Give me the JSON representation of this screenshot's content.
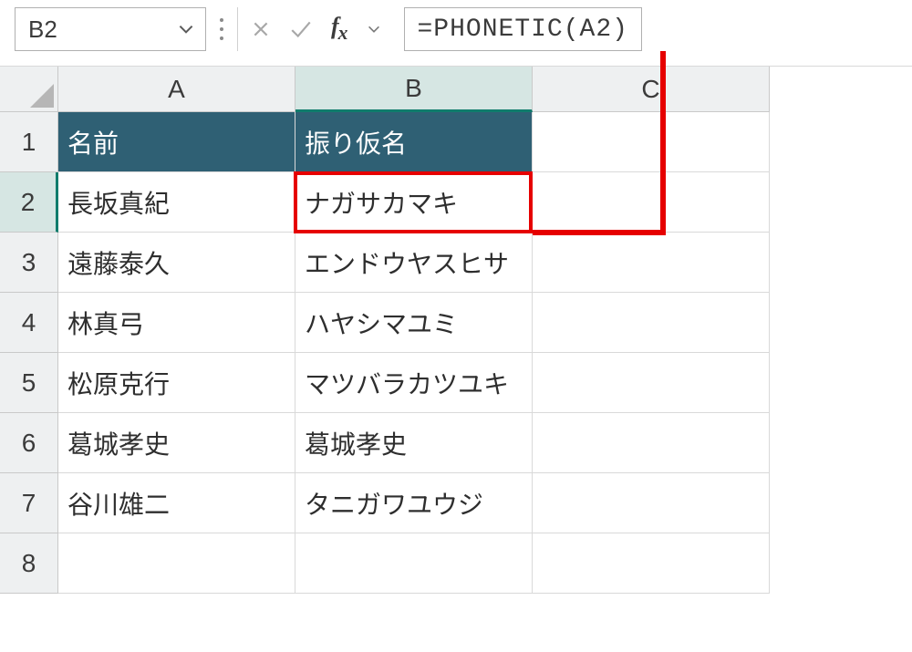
{
  "nameBox": "B2",
  "formula": "=PHONETIC(A2)",
  "columns": [
    "A",
    "B",
    "C"
  ],
  "rows": [
    "1",
    "2",
    "3",
    "4",
    "5",
    "6",
    "7",
    "8"
  ],
  "headers": {
    "A": "名前",
    "B": "振り仮名"
  },
  "data": [
    {
      "A": "長坂真紀",
      "B": "ナガサカマキ"
    },
    {
      "A": "遠藤泰久",
      "B": "エンドウヤスヒサ"
    },
    {
      "A": "林真弓",
      "B": "ハヤシマユミ"
    },
    {
      "A": "松原克行",
      "B": "マツバラカツユキ"
    },
    {
      "A": "葛城孝史",
      "B": "葛城孝史"
    },
    {
      "A": "谷川雄二",
      "B": "タニガワユウジ"
    }
  ],
  "selectedCell": "B2",
  "icons": {
    "chevronDown": "chevron-down",
    "cancel": "x",
    "enter": "check",
    "fx": "fx"
  }
}
